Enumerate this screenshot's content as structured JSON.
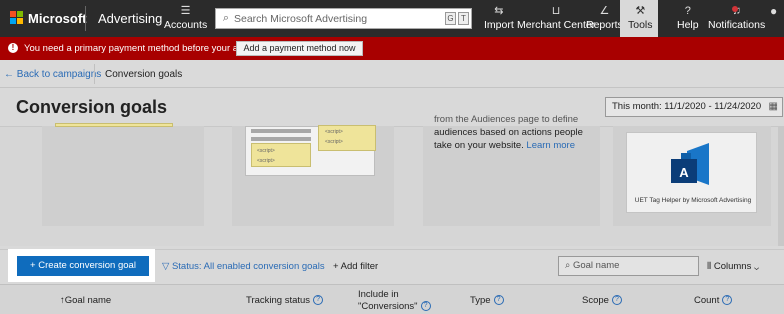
{
  "topbar": {
    "brand": "Microsoft",
    "product": "Advertising",
    "accounts_label": "Accounts",
    "search_placeholder": "Search Microsoft Advertising",
    "search_keys": [
      "G",
      "T"
    ],
    "nav": [
      {
        "label": "Import",
        "icon": "import-icon"
      },
      {
        "label": "Merchant Center",
        "icon": "shopping-cart-icon"
      },
      {
        "label": "Reports",
        "icon": "chart-icon"
      },
      {
        "label": "Tools",
        "icon": "wrench-icon"
      },
      {
        "label": "Help",
        "icon": "question-icon"
      },
      {
        "label": "Notifications",
        "icon": "bell-icon"
      }
    ]
  },
  "banner": {
    "message": "You need a primary payment method before your ads will run.",
    "button": "Add a payment method now",
    "color": "#a80000"
  },
  "breadcrumb": {
    "back": "Back to campaigns",
    "current": "Conversion goals"
  },
  "page": {
    "title": "Conversion goals",
    "date_range": "This month: 11/1/2020 - 11/24/2020"
  },
  "cards": {
    "audiences_text_top": "from the Audiences page to define",
    "audiences_text": "audiences based on actions people take on your website.",
    "learn_more": "Learn more",
    "helper_caption": "UET Tag Helper by Microsoft Advertising",
    "code_tag": "<script>"
  },
  "toolbar": {
    "create_button": "Create conversion goal",
    "status_filter": "Status: All enabled conversion goals",
    "add_filter": "Add filter",
    "search_placeholder": "Goal name",
    "columns": "Columns"
  },
  "table": {
    "headers": [
      {
        "label": "Goal name",
        "sortable": true
      },
      {
        "label": "Tracking status",
        "help": true
      },
      {
        "label": "Include in \"Conversions\"",
        "help": true
      },
      {
        "label": "Type",
        "help": true
      },
      {
        "label": "Scope",
        "help": true
      },
      {
        "label": "Count",
        "help": true
      }
    ]
  },
  "colors": {
    "accent": "#0f6cbd",
    "link": "#2a6bb5",
    "topbar": "#2b2b2b"
  }
}
